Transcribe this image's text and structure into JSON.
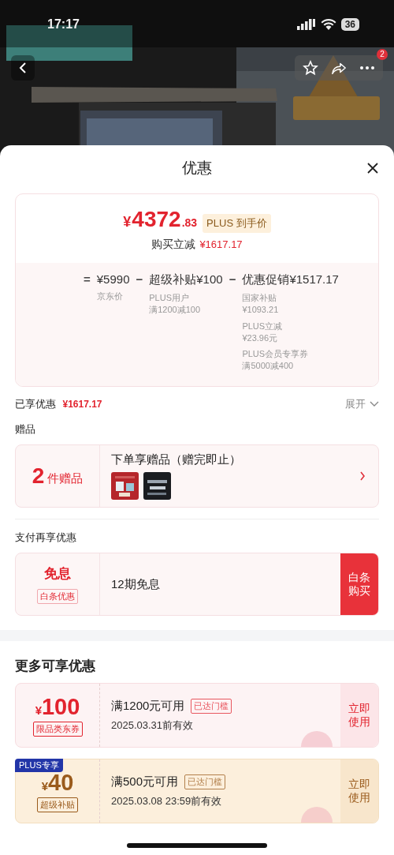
{
  "status_bar": {
    "time": "17:17",
    "battery": "36"
  },
  "header": {
    "more_badge": "2"
  },
  "sheet": {
    "title": "优惠"
  },
  "price_card": {
    "currency": "¥",
    "integer": "4372",
    "fraction": ".83",
    "tag": "PLUS 到手价",
    "saving_label": "购买立减",
    "saving_value": "¥1617.17",
    "breakdown": [
      {
        "operator": "=",
        "amount": "¥5990",
        "notes": [
          [
            "京东价"
          ]
        ]
      },
      {
        "operator": "−",
        "amount": "超级补贴¥100",
        "notes": [
          [
            "PLUS用户",
            "满1200减100"
          ]
        ]
      },
      {
        "operator": "−",
        "amount": "优惠促销¥1517.17",
        "notes": [
          [
            "国家补贴",
            "¥1093.21"
          ],
          [
            "PLUS立减",
            "¥23.96元"
          ],
          [
            "PLUS会员专享券",
            "满5000减400"
          ]
        ]
      }
    ]
  },
  "enjoyed": {
    "label": "已享优惠",
    "value": "¥1617.17",
    "toggle": "展开",
    "expanded": false
  },
  "gifts": {
    "heading": "赠品",
    "count": "2",
    "unit": "件赠品",
    "title": "下单享赠品（赠完即止）"
  },
  "payment": {
    "heading": "支付再享优惠",
    "title": "免息",
    "tag": "白条优惠",
    "offer": "12期免息",
    "action": "白条购买"
  },
  "more": {
    "heading": "更多可享优惠",
    "coupons": [
      {
        "kind": "standard",
        "currency": "¥",
        "amount": "100",
        "tag": "限品类东券",
        "condition": "满1200元可用",
        "status": "已达门槛",
        "validity": "2025.03.31前有效",
        "action": "立即使用"
      },
      {
        "kind": "plus",
        "ribbon": "PLUS专享",
        "currency": "¥",
        "amount": "40",
        "tag": "超级补贴",
        "condition": "满500元可用",
        "status": "已达门槛",
        "validity": "2025.03.08 23:59前有效",
        "action": "立即使用"
      }
    ]
  }
}
